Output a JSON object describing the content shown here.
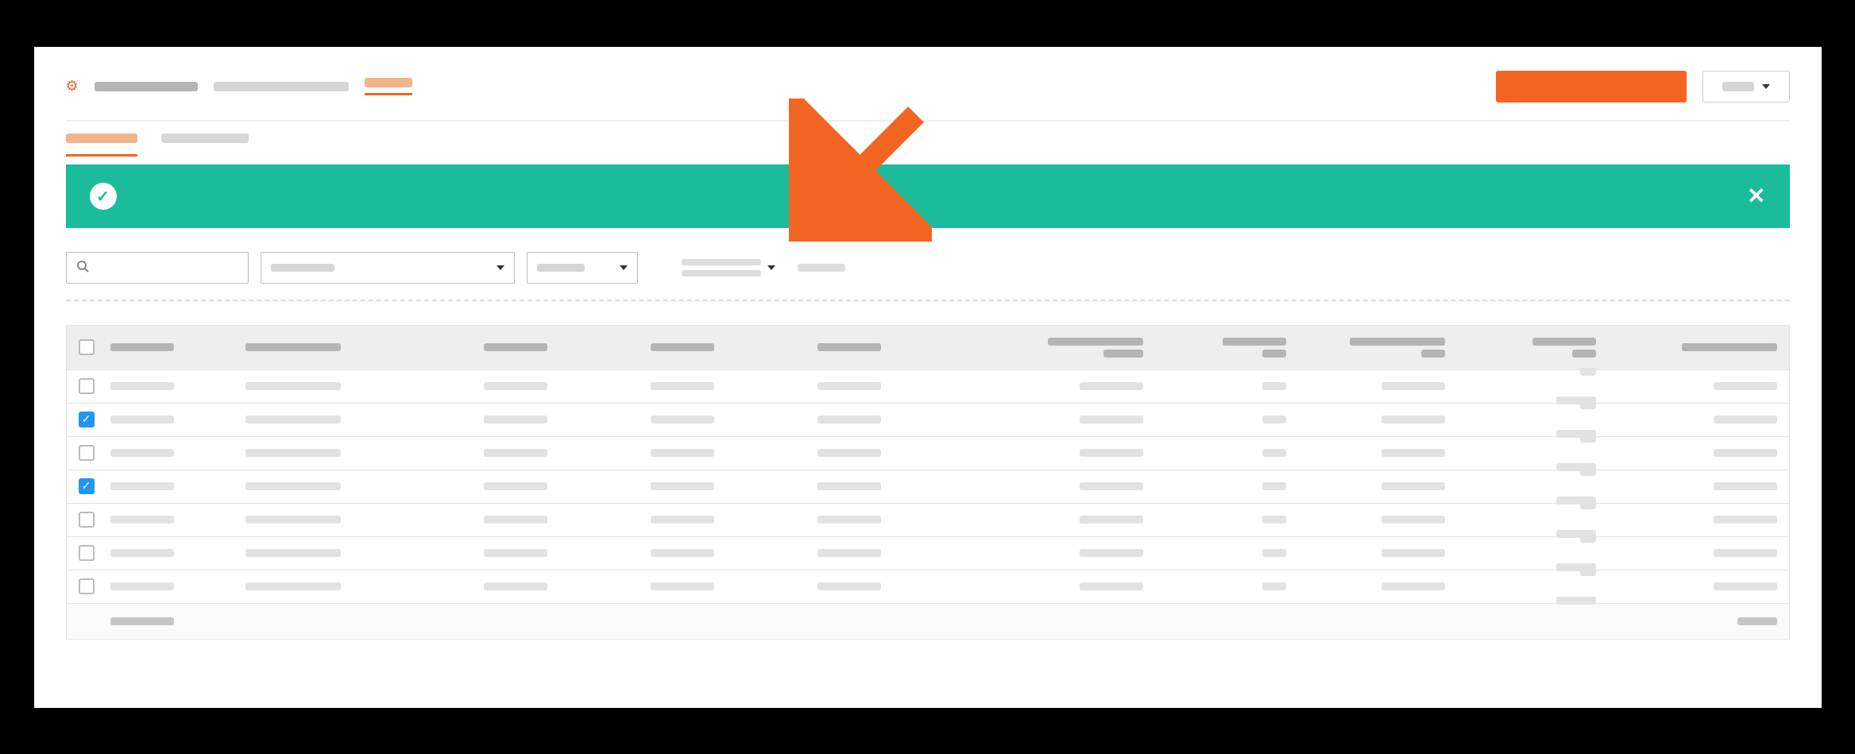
{
  "colors": {
    "accent": "#f26522",
    "success": "#1abc9c",
    "checkbox_checked": "#2196f3"
  },
  "topnav": {
    "items": [
      {
        "label": ""
      },
      {
        "label": ""
      },
      {
        "label": ""
      }
    ],
    "primary_button_label": "",
    "dropdown_label": ""
  },
  "tabs": [
    {
      "label": "",
      "active": true
    },
    {
      "label": "",
      "active": false
    }
  ],
  "banner": {
    "type": "success",
    "message": "",
    "dismissed": false
  },
  "filters": {
    "search_placeholder": "",
    "select_1_value": "",
    "select_2_value": "",
    "meta_line_1": "",
    "meta_line_2": "",
    "meta_extra": ""
  },
  "table": {
    "columns": [
      {
        "label": ""
      },
      {
        "label": ""
      },
      {
        "label": ""
      },
      {
        "label": ""
      },
      {
        "label": ""
      },
      {
        "label_line1": "",
        "label_line2": ""
      },
      {
        "label_line1": "",
        "label_line2": ""
      },
      {
        "label_line1": "",
        "label_line2": ""
      },
      {
        "label_line1": "",
        "label_line2": ""
      },
      {
        "label": ""
      }
    ],
    "rows": [
      {
        "checked": false
      },
      {
        "checked": true
      },
      {
        "checked": false
      },
      {
        "checked": true
      },
      {
        "checked": false
      },
      {
        "checked": false
      },
      {
        "checked": false
      }
    ],
    "footer_left": "",
    "footer_right": ""
  }
}
